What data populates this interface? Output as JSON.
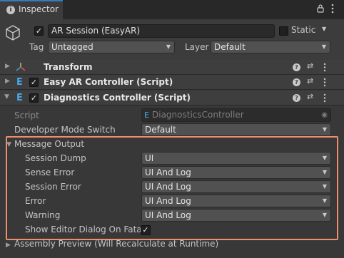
{
  "tab": {
    "label": "Inspector"
  },
  "object": {
    "name": "AR Session (EasyAR)",
    "active": true,
    "static_label": "Static"
  },
  "tag": {
    "label": "Tag",
    "value": "Untagged"
  },
  "layer": {
    "label": "Layer",
    "value": "Default"
  },
  "components": [
    {
      "title": "Transform",
      "icon": "transform-icon"
    },
    {
      "title": "Easy AR Controller (Script)",
      "enabled": true,
      "icon": "script-icon"
    },
    {
      "title": "Diagnostics Controller (Script)",
      "enabled": true,
      "icon": "script-icon"
    }
  ],
  "props": {
    "script_label": "Script",
    "script_value": "DiagnosticsController",
    "dev_mode_label": "Developer Mode Switch",
    "dev_mode_value": "Default",
    "message_output_label": "Message Output",
    "session_dump_label": "Session Dump",
    "session_dump_value": "UI",
    "sense_error_label": "Sense Error",
    "sense_error_value": "UI And Log",
    "session_error_label": "Session Error",
    "session_error_value": "UI And Log",
    "error_label": "Error",
    "error_value": "UI And Log",
    "warning_label": "Warning",
    "warning_value": "UI And Log",
    "show_dialog_label": "Show Editor Dialog On Fatal",
    "show_dialog_value": true,
    "assembly_preview_label": "Assembly Preview (Will Recalculate at Runtime)"
  },
  "colors": {
    "highlight": "#ef8e6c",
    "tab_accent": "#3a79bb",
    "background": "#383838"
  }
}
